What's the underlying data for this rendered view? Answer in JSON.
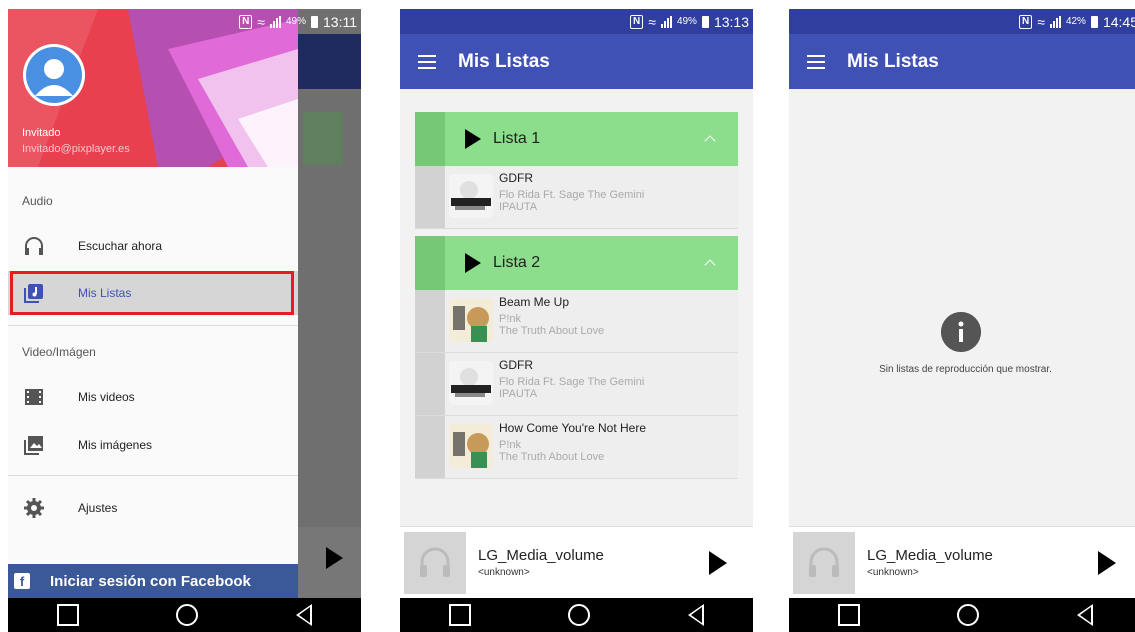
{
  "status_bars": [
    {
      "battery": "49%",
      "time": "13:11"
    },
    {
      "battery": "49%",
      "time": "13:13"
    },
    {
      "battery": "42%",
      "time": "14:45"
    }
  ],
  "drawer": {
    "user_name": "Invitado",
    "user_email": "Invitado@pixplayer.es",
    "section_audio": "Audio",
    "item_escuchar": "Escuchar ahora",
    "item_mis_listas": "Mis Listas",
    "section_video": "Video/Imágen",
    "item_mis_videos": "Mis videos",
    "item_mis_imagenes": "Mis imágenes",
    "item_ajustes": "Ajustes",
    "facebook_login": "Iniciar sesión con Facebook"
  },
  "appbar_title": "Mis Listas",
  "playlists": [
    {
      "name": "Lista 1",
      "songs": [
        {
          "title": "GDFR",
          "artist": "Flo Rida Ft. Sage The Gemini",
          "album": "IPAUTA"
        }
      ]
    },
    {
      "name": "Lista 2",
      "songs": [
        {
          "title": "Beam Me Up",
          "artist": "P!nk",
          "album": "The Truth About Love"
        },
        {
          "title": "GDFR",
          "artist": "Flo Rida Ft. Sage The Gemini",
          "album": "IPAUTA"
        },
        {
          "title": "How Come You're Not Here",
          "artist": "P!nk",
          "album": "The Truth About Love"
        }
      ]
    }
  ],
  "player": {
    "title": "LG_Media_volume",
    "subtitle": "<unknown>"
  },
  "empty_message": "Sin listas de reproducción que mostrar.",
  "colors": {
    "appbar": "#3f51b5",
    "list_header": "#8cdd8c",
    "facebook": "#3b5998",
    "highlight": "#e51c23"
  }
}
